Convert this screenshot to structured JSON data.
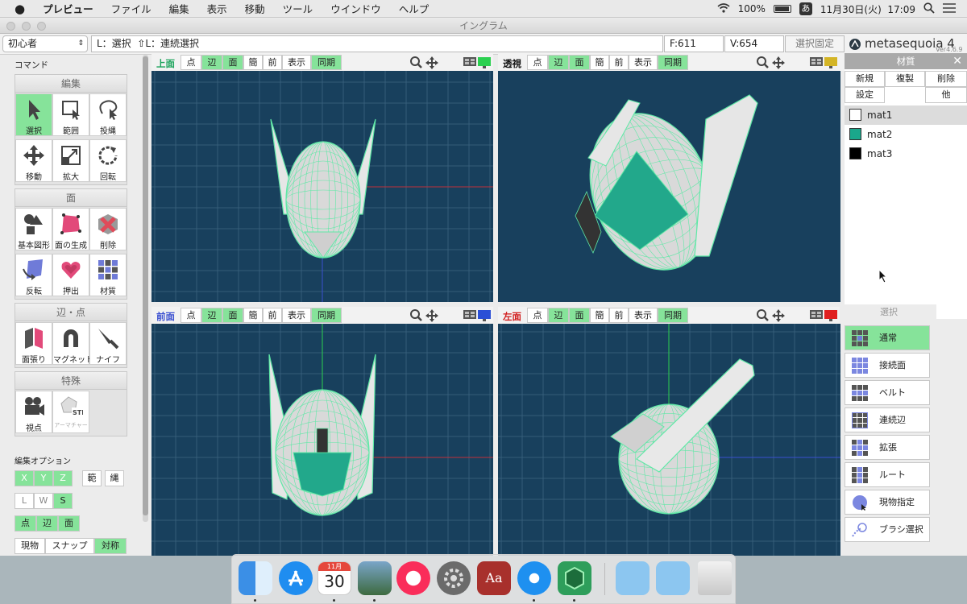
{
  "menubar": {
    "app": "プレビュー",
    "items": [
      "ファイル",
      "編集",
      "表示",
      "移動",
      "ツール",
      "ウインドウ",
      "ヘルプ"
    ],
    "battery": "100%",
    "input_method": "あ",
    "datetime": "11月30日(火)  17:09"
  },
  "window": {
    "title": "イングラム"
  },
  "toolbar": {
    "mode": "初心者",
    "hint": "L：選択  ⇧L：連続選択",
    "faces": "F:611",
    "vertices": "V:654",
    "lock": "選択固定",
    "logo": "metasequoia 4",
    "version": "Ver4.6.9"
  },
  "left": {
    "command_label": "コマンド",
    "groups": {
      "edit": "編集",
      "face": "面",
      "edge": "辺・点",
      "special": "特殊"
    },
    "edit_buttons": [
      "選択",
      "範囲",
      "投縄",
      "移動",
      "拡大",
      "回転"
    ],
    "face_buttons": [
      "基本図形",
      "面の生成",
      "削除",
      "反転",
      "押出",
      "材質"
    ],
    "edge_buttons": [
      "面張り",
      "マグネット",
      "ナイフ"
    ],
    "special_buttons": [
      "視点",
      "アーマチャー"
    ],
    "options_label": "編集オプション",
    "axis": [
      "X",
      "Y",
      "Z"
    ],
    "range": "範",
    "lasso": "縄",
    "lws": [
      "L",
      "W",
      "S"
    ],
    "targets": [
      "点",
      "辺",
      "面"
    ],
    "bottom": [
      "現物",
      "スナップ",
      "対称"
    ]
  },
  "viewports": [
    {
      "label": "上面",
      "label_color": "#1aa35a"
    },
    {
      "label": "透視",
      "label_color": "#111111"
    },
    {
      "label": "前面",
      "label_color": "#3a4fd0"
    },
    {
      "label": "左面",
      "label_color": "#d11b1b"
    }
  ],
  "view_buttons": {
    "point": "点",
    "edge": "辺",
    "face": "面",
    "simple": "簡",
    "front": "前",
    "display": "表示",
    "sync": "同期"
  },
  "materials": {
    "title": "材質",
    "buttons": [
      "新規",
      "複製",
      "削除",
      "設定",
      "他"
    ],
    "items": [
      {
        "name": "mat1",
        "color": "#ffffff"
      },
      {
        "name": "mat2",
        "color": "#1aa78b"
      },
      {
        "name": "mat3",
        "color": "#000000"
      }
    ]
  },
  "selection": {
    "title": "選択",
    "modes": [
      "通常",
      "接続面",
      "ベルト",
      "連続辺",
      "拡張",
      "ルート",
      "現物指定",
      "ブラシ選択"
    ]
  },
  "dock": {
    "calendar_month": "11月",
    "calendar_day": "30"
  },
  "colors": {
    "accent": "#86e39a",
    "viewport_bg": "#18405d",
    "wire": "#5fe8a6"
  }
}
